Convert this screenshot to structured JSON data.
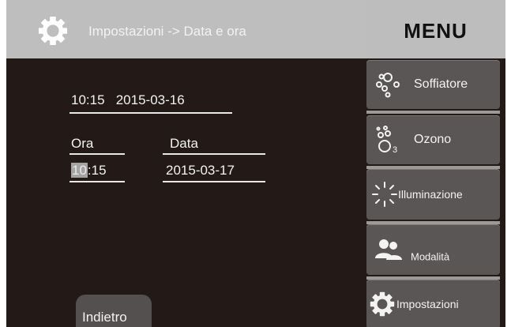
{
  "header": {
    "title": "Impostazioni -> Data e ora"
  },
  "menu": {
    "title": "MENU",
    "items": [
      {
        "label": "Soffiatore",
        "icon": "blower-icon"
      },
      {
        "label": "Ozono",
        "icon": "ozone-icon"
      },
      {
        "label": "Illuminazione",
        "icon": "light-icon"
      },
      {
        "label": "Modalità",
        "icon": "people-icon"
      },
      {
        "label": "Impostazioni",
        "icon": "gear-icon"
      }
    ]
  },
  "current": {
    "time": "10:15",
    "date": "2015-03-16"
  },
  "form": {
    "ora_label": "Ora",
    "data_label": "Data",
    "hour": "10",
    "minute_rest": ":15",
    "date_value": "2015-03-17"
  },
  "back_label": "Indietro",
  "colors": {
    "background": "#231a17",
    "header": "#bebebe",
    "menu_button": "#5a5655",
    "highlight": "#a4a4a4"
  }
}
